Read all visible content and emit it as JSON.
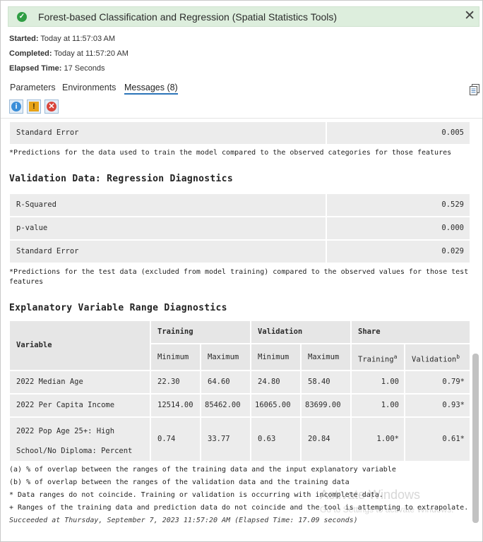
{
  "header": {
    "title": "Forest-based Classification and Regression (Spatial Statistics Tools)",
    "success_icon": "✓",
    "close_icon": "✕"
  },
  "meta": {
    "started_label": "Started:",
    "started_value": "Today at 11:57:03 AM",
    "completed_label": "Completed:",
    "completed_value": "Today at 11:57:20 AM",
    "elapsed_label": "Elapsed Time:",
    "elapsed_value": "17 Seconds"
  },
  "tabs": [
    "Parameters",
    "Environments",
    "Messages (8)"
  ],
  "filters": {
    "info": "i",
    "warning": "!",
    "error": "✕"
  },
  "training_tail": {
    "row_label": "Standard Error",
    "row_value": "0.005",
    "footnote": "*Predictions for the data used to train the model compared to the observed categories for those features"
  },
  "validation": {
    "title": "Validation Data: Regression Diagnostics",
    "rows": [
      {
        "label": "R-Squared",
        "value": "0.529"
      },
      {
        "label": "p-value",
        "value": "0.000"
      },
      {
        "label": "Standard Error",
        "value": "0.029"
      }
    ],
    "footnote_line1": "*Predictions for the test data (excluded from model training) compared to the observed values for those test",
    "footnote_line2": "features"
  },
  "range": {
    "title": "Explanatory Variable Range Diagnostics",
    "headers": {
      "variable": "Variable",
      "training": "Training",
      "validation": "Validation",
      "share": "Share",
      "minimum": "Minimum",
      "maximum": "Maximum",
      "share_training": "Training",
      "share_training_sup": "a",
      "share_validation": "Validation",
      "share_validation_sup": "b"
    },
    "rows": [
      {
        "variable": "2022 Median Age",
        "tmin": "22.30",
        "tmax": "64.60",
        "vmin": "24.80",
        "vmax": "58.40",
        "st": "1.00",
        "sv": "0.79*"
      },
      {
        "variable": "2022 Per Capita Income",
        "tmin": "12514.00",
        "tmax": "85462.00",
        "vmin": "16065.00",
        "vmax": "83699.00",
        "st": "1.00",
        "sv": "0.93*"
      },
      {
        "variable_line1": "2022 Pop Age 25+: High",
        "variable_line2": "School/No Diploma: Percent",
        "tmin": "0.74",
        "tmax": "33.77",
        "vmin": "0.63",
        "vmax": "20.84",
        "st": "1.00*",
        "sv": "0.61*"
      }
    ],
    "notes": [
      "(a) % of overlap between the ranges of the training data and the input explanatory variable",
      "(b) % of overlap between the ranges of the validation data and the training data",
      "* Data ranges do not coincide. Training or validation is occurring with incomplete data.",
      "+ Ranges of the training data and prediction data do not coincide and the tool is attempting to extrapolate."
    ]
  },
  "status_line": "Succeeded at Thursday, September 7, 2023 11:57:20 AM (Elapsed Time: 17.09 seconds)",
  "watermark": {
    "line1": "Activate Windows",
    "line2": "Go to Settings to activate Windows."
  }
}
